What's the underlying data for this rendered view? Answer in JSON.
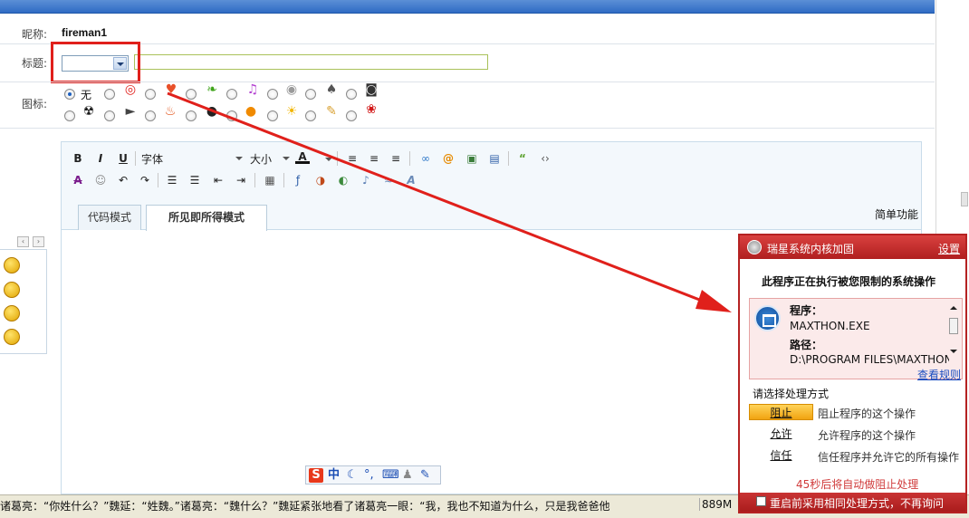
{
  "form": {
    "nick_label": "昵称:",
    "nick_value": "fireman1",
    "title_label": "标题:",
    "icon_label": "图标:",
    "icon_none_label": "无"
  },
  "editor": {
    "toolbar": {
      "bold": "B",
      "italic": "I",
      "underline": "U",
      "font_label": "字体",
      "size_label": "大小",
      "font_color": "A"
    },
    "tabs": {
      "code_mode": "代码模式",
      "wysiwyg_mode": "所见即所得模式"
    },
    "simple_func": "简单功能"
  },
  "ime": {
    "brand": "S",
    "lang": "中"
  },
  "statusbar": {
    "text": "诸葛亮：“你姓什么？”魏延：“姓魏。”诸葛亮：“魏什么？”魏延紧张地看了诸葛亮一眼：“我，我也不知道为什么，只是我爸爸他",
    "mem": "889M"
  },
  "popup": {
    "title": "瑞星系统内核加固",
    "settings": "设置",
    "heading": "此程序正在执行被您限制的系统操作",
    "program_label": "程序：",
    "program_value": "MAXTHON.EXE",
    "path_label": "路径：",
    "path_value": "D:\\PROGRAM FILES\\MAXTHON",
    "view_rules": "查看规则",
    "choose_label": "请选择处理方式",
    "options": [
      {
        "button": "阻止",
        "desc": "阻止程序的这个操作"
      },
      {
        "button": "允许",
        "desc": "允许程序的这个操作"
      },
      {
        "button": "信任",
        "desc": "信任程序并允许它的所有操作"
      }
    ],
    "countdown": "45秒后将自动做阻止处理",
    "remember": "重启前采用相同处理方式，不再询问"
  },
  "colors": {
    "top_bar": "#2f6bc4",
    "highlight": "#e0201b",
    "popup_red": "#b52222",
    "link_blue": "#1a4dc1"
  }
}
